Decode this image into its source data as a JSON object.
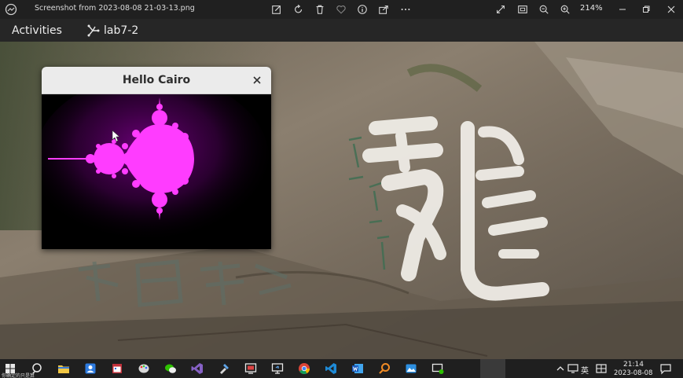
{
  "viewer": {
    "file_title": "Screenshot from 2023-08-08 21-03-13.png",
    "zoom_level": "214%",
    "toolbar_icons": [
      "edit-icon",
      "rotate-icon",
      "delete-icon",
      "favorite-icon",
      "info-icon",
      "share-icon",
      "more-icon"
    ],
    "right_icons": [
      "fullscreen-icon",
      "fit-icon",
      "zoom-out-icon",
      "zoom-in-icon"
    ]
  },
  "gnome": {
    "activities": "Activities",
    "app_label": "lab7-2"
  },
  "cairo_window": {
    "title": "Hello Cairo",
    "colors": {
      "set": "#ff3cff",
      "halo": "#6a006e",
      "background": "#000000"
    }
  },
  "taskbar": {
    "caption": "你确定的只是算",
    "tray_lang": "英",
    "time": "21:14",
    "date": "2023-08-08",
    "apps": [
      "start-icon",
      "search-icon",
      "file-explorer-icon",
      "contacts-icon",
      "calendar-icon",
      "paint-icon",
      "wechat-icon",
      "visual-studio-icon",
      "tool-icon",
      "screen-tool-icon",
      "remote-desktop-icon",
      "chrome-icon",
      "vscode-icon",
      "word-icon",
      "search-tool-icon",
      "photos-icon",
      "chat-icon"
    ]
  }
}
